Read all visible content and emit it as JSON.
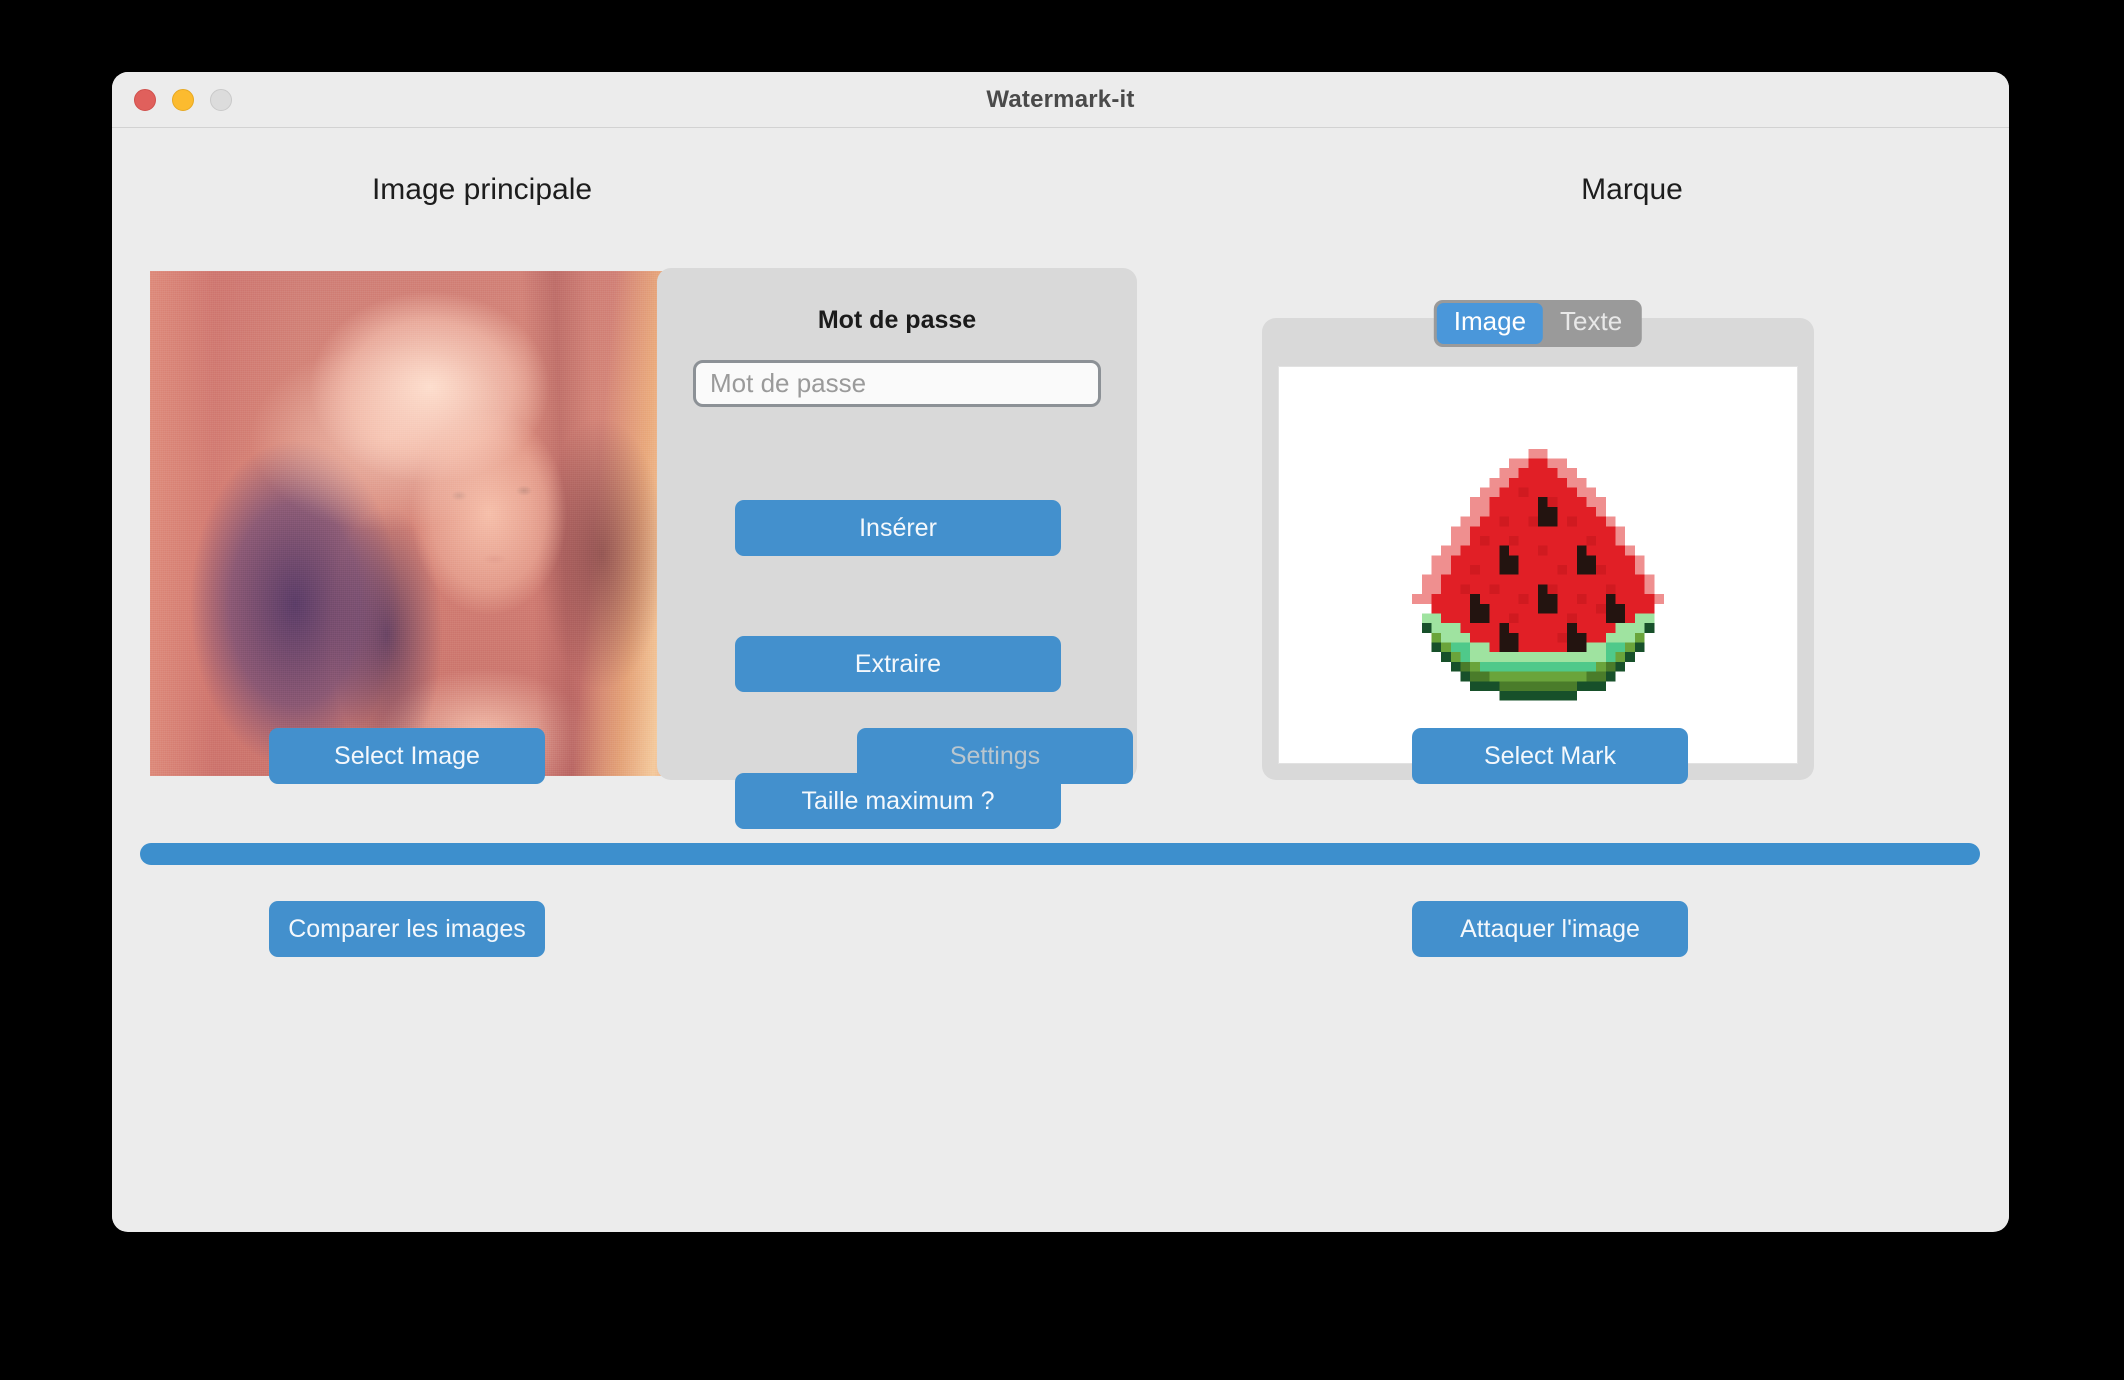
{
  "window": {
    "title": "Watermark-it",
    "traffic_lights": [
      {
        "name": "close",
        "color": "#e0605c"
      },
      {
        "name": "minimize",
        "color": "#fcbb2f"
      },
      {
        "name": "zoom",
        "color": "#dcdcdc"
      }
    ]
  },
  "headings": {
    "main_image": "Image principale",
    "mark": "Marque"
  },
  "password": {
    "label": "Mot de passe",
    "placeholder": "Mot de passe",
    "value": ""
  },
  "center_buttons": {
    "insert": "Insérer",
    "extract": "Extraire",
    "max_size": "Taille maximum ?"
  },
  "mark": {
    "segments": [
      {
        "label": "Image",
        "selected": true
      },
      {
        "label": "Texte",
        "selected": false
      }
    ],
    "preview_icon": "watermelon-slice-image"
  },
  "action_buttons": {
    "select_image": "Select Image",
    "settings": "Settings",
    "select_mark": "Select Mark",
    "compare_images": "Comparer les images",
    "attack_image": "Attaquer l'image"
  },
  "progress": {
    "percent": 100
  },
  "colors": {
    "accent_blue": "#4390cd",
    "panel_gray": "#d9d9d9",
    "window_gray": "#ececec",
    "segment_track": "#9a9a9a",
    "disabled_text": "#b9c6cf"
  }
}
